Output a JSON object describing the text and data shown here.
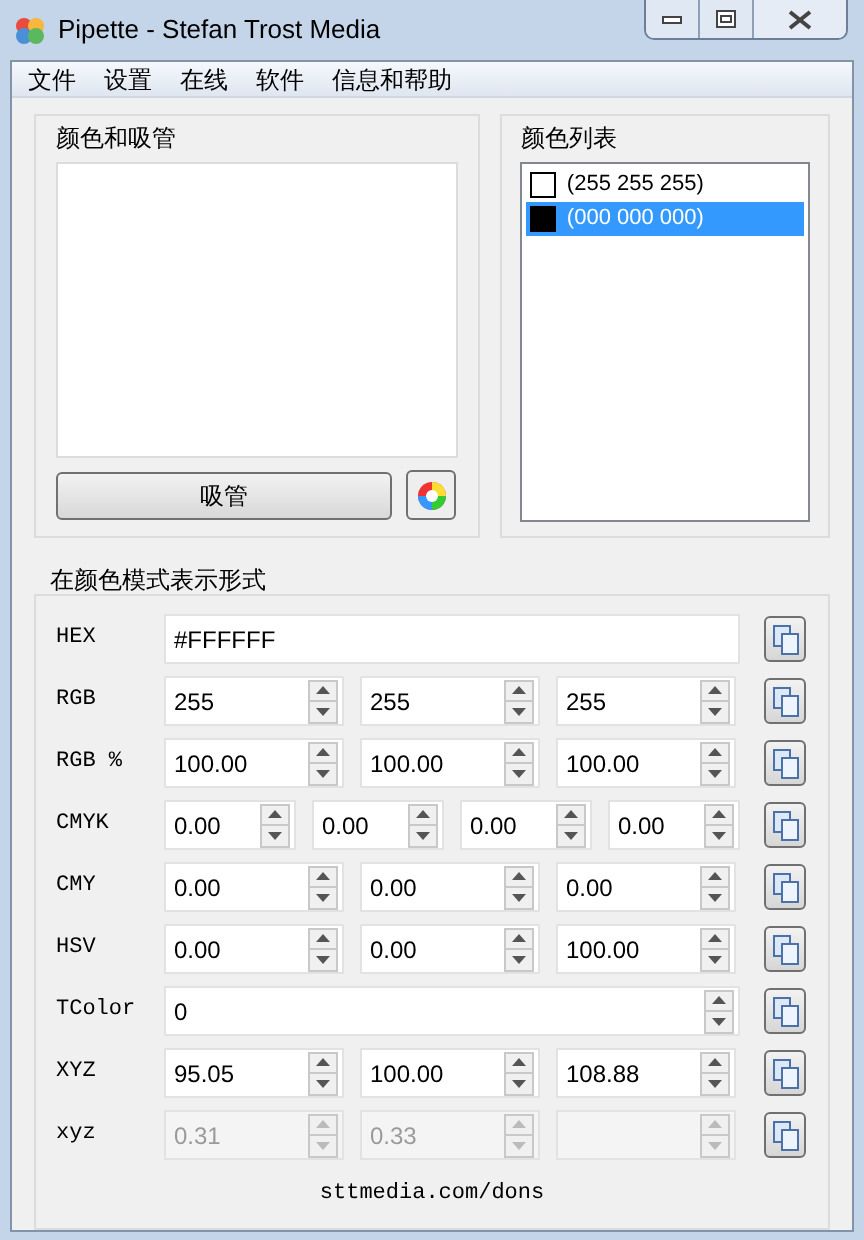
{
  "window": {
    "title": "Pipette - Stefan Trost Media"
  },
  "menu": [
    "文件",
    "设置",
    "在线",
    "软件",
    "信息和帮助"
  ],
  "picker": {
    "title": "颜色和吸管",
    "button": "吸管"
  },
  "color_list": {
    "title": "颜色列表",
    "items": [
      {
        "label": "(255 255 255)",
        "color": "#ffffff",
        "selected": false
      },
      {
        "label": "(000 000 000)",
        "color": "#000000",
        "selected": true
      }
    ]
  },
  "modes": {
    "title": "在颜色模式表示形式",
    "rows": [
      {
        "label": "HEX",
        "kind": "text",
        "disabled": false,
        "fields": [
          "#FFFFFF"
        ]
      },
      {
        "label": "RGB",
        "kind": "spin",
        "disabled": false,
        "fields": [
          "255",
          "255",
          "255"
        ]
      },
      {
        "label": "RGB %",
        "kind": "spin",
        "disabled": false,
        "fields": [
          "100.00",
          "100.00",
          "100.00"
        ]
      },
      {
        "label": "CMYK",
        "kind": "spin",
        "disabled": false,
        "fields": [
          "0.00",
          "0.00",
          "0.00",
          "0.00"
        ]
      },
      {
        "label": "CMY",
        "kind": "spin",
        "disabled": false,
        "fields": [
          "0.00",
          "0.00",
          "0.00"
        ]
      },
      {
        "label": "HSV",
        "kind": "spin",
        "disabled": false,
        "fields": [
          "0.00",
          "0.00",
          "100.00"
        ]
      },
      {
        "label": "TColor",
        "kind": "spin",
        "disabled": false,
        "fields": [
          "0"
        ]
      },
      {
        "label": "XYZ",
        "kind": "spin",
        "disabled": false,
        "fields": [
          "95.05",
          "100.00",
          "108.88"
        ]
      },
      {
        "label": "xyz",
        "kind": "spin",
        "disabled": true,
        "fields": [
          "0.31",
          "0.33"
        ],
        "covered_field": true
      }
    ]
  },
  "footer_link": "sttmedia.com/dons"
}
